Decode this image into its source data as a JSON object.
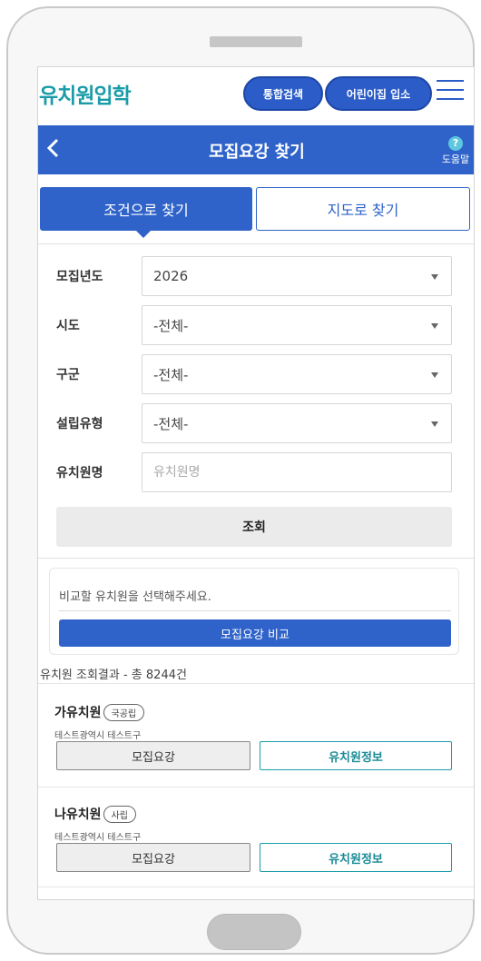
{
  "header": {
    "logo": "유치원입학",
    "search_button": "통합검색",
    "daycare_button": "어린이집 입소"
  },
  "titlebar": {
    "title": "모집요강 찾기",
    "help_label": "도움말",
    "help_symbol": "?"
  },
  "tabs": {
    "condition": "조건으로 찾기",
    "map": "지도로 찾기"
  },
  "form": {
    "year_label": "모집년도",
    "year_value": "2026",
    "sido_label": "시도",
    "sido_value": "-전체-",
    "gugun_label": "구군",
    "gugun_value": "-전체-",
    "type_label": "설립유형",
    "type_value": "-전체-",
    "name_label": "유치원명",
    "name_placeholder": "유치원명",
    "search_button": "조회"
  },
  "compare": {
    "prompt": "비교할 유치원을 선택해주세요.",
    "button": "모집요강 비교"
  },
  "results": {
    "summary": "유치원 조회결과 - 총 8244건",
    "items": [
      {
        "name": "가유치원",
        "type": "국공립",
        "address": "테스트광역시 테스트구",
        "recruit_button": "모집요강",
        "info_button": "유치원정보"
      },
      {
        "name": "나유치원",
        "type": "사립",
        "address": "테스트광역시 테스트구",
        "recruit_button": "모집요강",
        "info_button": "유치원정보"
      }
    ]
  },
  "colors": {
    "brand_blue": "#2f63c9",
    "logo_teal": "#1a9ca8"
  }
}
